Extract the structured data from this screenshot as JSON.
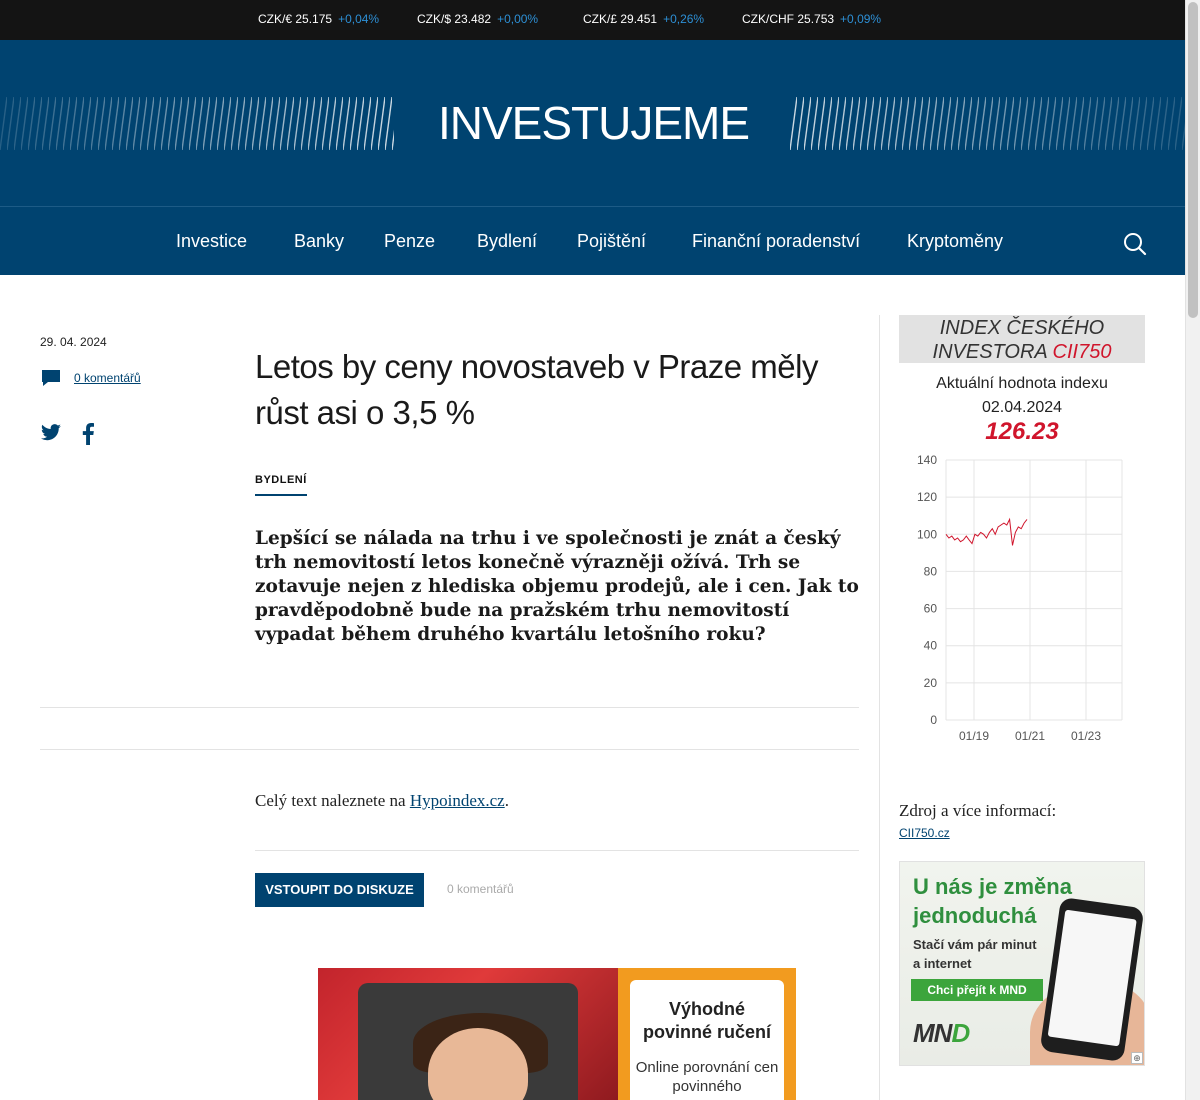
{
  "ticker": [
    {
      "pair": "CZK/€",
      "rate": "25.175",
      "change": "+0,04%"
    },
    {
      "pair": "CZK/$",
      "rate": "23.482",
      "change": "+0,00%"
    },
    {
      "pair": "CZK/£",
      "rate": "29.451",
      "change": "+0,26%"
    },
    {
      "pair": "CZK/CHF",
      "rate": "25.753",
      "change": "+0,09%"
    }
  ],
  "header": {
    "logo": "INVESTUJEME"
  },
  "nav": {
    "items": [
      "Investice",
      "Banky",
      "Penze",
      "Bydlení",
      "Pojištění",
      "Finanční poradenství",
      "Kryptoměny"
    ],
    "search_icon": "search-icon"
  },
  "article": {
    "date": "29. 04. 2024",
    "comments_link": "0 komentářů",
    "title": "Letos by ceny novostaveb v Praze měly růst asi o 3,5 %",
    "category": "BYDLENÍ",
    "perex": "Lepšící se nálada na trhu i ve společnosti je znát a český trh nemovitostí letos konečně výrazněji ožívá. Trh se zotavuje nejen z hlediska objemu prodejů, ale i cen. Jak to pravděpodobně bude na pražském trhu nemovitostí vypadat během druhého kvartálu letošního roku?",
    "body_prefix": "Celý text naleznete na ",
    "body_link": "Hypoindex.cz",
    "body_suffix": ".",
    "discuss_button": "VSTOUPIT DO DISKUZE",
    "discuss_count": "0 komentářů"
  },
  "sidebar": {
    "cii_title_1": "INDEX ČESKÉHO",
    "cii_title_2": "INVESTORA ",
    "cii_code": "CII750",
    "current_label": "Aktuální hodnota indexu",
    "current_date": "02.04.2024",
    "current_value": "126.23",
    "source_label": "Zdroj a více informací:",
    "source_link": "CII750.cz"
  },
  "chart_data": {
    "type": "line",
    "ylim": [
      0,
      140
    ],
    "yticks": [
      "0",
      "20",
      "40",
      "60",
      "80",
      "100",
      "120",
      "140"
    ],
    "xticks": [
      "01/19",
      "01/21",
      "01/23"
    ],
    "grid": true,
    "series": [
      {
        "color": "#d0152c",
        "values": [
          100,
          98,
          99,
          97,
          98,
          96,
          97,
          99,
          97,
          95,
          100,
          99,
          101,
          100,
          98,
          101,
          103,
          100,
          104,
          105,
          106,
          105,
          108,
          94,
          101,
          104,
          103,
          106,
          108
        ]
      }
    ]
  },
  "ad_bottom": {
    "heading": "Výhodné povinné ručení",
    "text": "Online porovnání cen povinného"
  },
  "ad_side": {
    "heading_1": "U nás je změna",
    "heading_2": "jednoduchá",
    "sub_1": "Stačí vám pár minut",
    "sub_2": "a internet",
    "cta": "Chci přejít k MND",
    "brand": "MN",
    "brand_d": "D"
  },
  "colors": {
    "brand": "#004370",
    "accent_red": "#d0152c",
    "ticker_change": "#2d8fd5"
  }
}
